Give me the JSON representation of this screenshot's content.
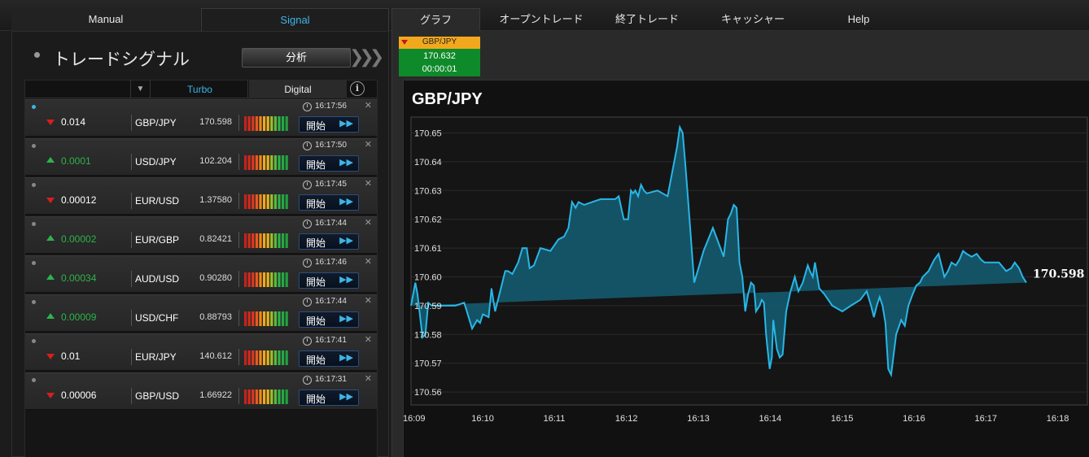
{
  "nav": {
    "manual": "Manual",
    "signal": "Signal",
    "graph": "グラフ",
    "open_trades": "オープントレード",
    "closed_trades": "終了トレード",
    "cashier": "キャッシャー",
    "help": "Help"
  },
  "signal_panel": {
    "title": "トレードシグナル",
    "analyze_label": "分析",
    "filter_value": "",
    "subtabs": {
      "turbo": "Turbo",
      "digital": "Digital"
    },
    "info_icon": "i",
    "rows": [
      {
        "direction": "down",
        "change": "0.014",
        "pair": "GBP/JPY",
        "price": "170.598",
        "time": "16:17:56",
        "active": true,
        "start": "開始"
      },
      {
        "direction": "up",
        "change": "0.0001",
        "pair": "USD/JPY",
        "price": "102.204",
        "time": "16:17:50",
        "active": false,
        "start": "開始"
      },
      {
        "direction": "down",
        "change": "0.00012",
        "pair": "EUR/USD",
        "price": "1.37580",
        "time": "16:17:45",
        "active": false,
        "start": "開始"
      },
      {
        "direction": "up",
        "change": "0.00002",
        "pair": "EUR/GBP",
        "price": "0.82421",
        "time": "16:17:44",
        "active": false,
        "start": "開始"
      },
      {
        "direction": "up",
        "change": "0.00034",
        "pair": "AUD/USD",
        "price": "0.90280",
        "time": "16:17:46",
        "active": false,
        "start": "開始"
      },
      {
        "direction": "up",
        "change": "0.00009",
        "pair": "USD/CHF",
        "price": "0.88793",
        "time": "16:17:44",
        "active": false,
        "start": "開始"
      },
      {
        "direction": "down",
        "change": "0.01",
        "pair": "EUR/JPY",
        "price": "140.612",
        "time": "16:17:41",
        "active": false,
        "start": "開始"
      },
      {
        "direction": "down",
        "change": "0.00006",
        "pair": "GBP/USD",
        "price": "1.66922",
        "time": "16:17:31",
        "active": false,
        "start": "開始"
      }
    ],
    "icons": {
      "close": "close-icon",
      "clock": "clock-icon",
      "start": "fast-forward-icon",
      "down": "triangle-down-icon",
      "up": "triangle-up-icon"
    },
    "colors": {
      "down": "#d91e1e",
      "up": "#2db34a",
      "accent": "#3fb4e6"
    }
  },
  "asset_chip": {
    "pair": "GBP/JPY",
    "price": "170.632",
    "timer": "00:00:01",
    "colors": {
      "head": "#f2a81d",
      "body": "#0f8a2a"
    }
  },
  "chart_data": {
    "type": "area",
    "title": "GBP/JPY",
    "last_price_label": "170.598",
    "xlabel": "",
    "ylabel": "",
    "x_ticks": [
      "16:09",
      "16:10",
      "16:11",
      "16:12",
      "16:13",
      "16:14",
      "16:15",
      "16:16",
      "16:17",
      "16:18"
    ],
    "y_ticks": [
      "170.56",
      "170.57",
      "170.58",
      "170.59",
      "170.60",
      "170.61",
      "170.62",
      "170.63",
      "170.64",
      "170.65"
    ],
    "xlim": [
      0,
      9.41
    ],
    "ylim": [
      170.5555,
      170.6555
    ],
    "grid": true,
    "legend": "none",
    "colors": {
      "line": "#29b6e6",
      "fill": "#145a6e"
    },
    "x": [
      0.0,
      0.06,
      0.09,
      0.16,
      0.2,
      0.24,
      0.29,
      0.38,
      0.41,
      0.46,
      0.53,
      0.62,
      0.74,
      0.85,
      0.92,
      0.96,
      1.0,
      1.08,
      1.12,
      1.17,
      1.22,
      1.27,
      1.31,
      1.35,
      1.41,
      1.49,
      1.55,
      1.61,
      1.65,
      1.71,
      1.8,
      1.94,
      2.05,
      2.13,
      2.19,
      2.24,
      2.29,
      2.33,
      2.41,
      2.52,
      2.64,
      2.76,
      2.84,
      2.89,
      2.96,
      3.02,
      3.06,
      3.09,
      3.12,
      3.16,
      3.2,
      3.24,
      3.28,
      3.43,
      3.57,
      3.7,
      3.74,
      3.78,
      3.82,
      3.86,
      3.94,
      4.07,
      4.2,
      4.35,
      4.41,
      4.45,
      4.49,
      4.53,
      4.57,
      4.61,
      4.65,
      4.69,
      4.73,
      4.77,
      4.8,
      4.85,
      4.88,
      4.91,
      4.94,
      4.96,
      4.99,
      5.02,
      5.04,
      5.09,
      5.13,
      5.17,
      5.22,
      5.28,
      5.34,
      5.39,
      5.45,
      5.52,
      5.55,
      5.59,
      5.62,
      5.68,
      5.75,
      5.86,
      6.0,
      6.12,
      6.25,
      6.34,
      6.4,
      6.44,
      6.48,
      6.52,
      6.56,
      6.6,
      6.64,
      6.68,
      6.75,
      6.82,
      6.87,
      6.92,
      6.98,
      7.03,
      7.08,
      7.12,
      7.2,
      7.28,
      7.34,
      7.38,
      7.42,
      7.47,
      7.52,
      7.58,
      7.63,
      7.68,
      7.73,
      7.8,
      7.87,
      7.93,
      7.98,
      8.08,
      8.18,
      8.28,
      8.35,
      8.4,
      8.46,
      8.51,
      8.56,
      8.64,
      8.72,
      8.8,
      8.87,
      8.95,
      9.0,
      9.06,
      9.12,
      9.2,
      9.27,
      9.34,
      9.41
    ],
    "y": [
      170.59,
      170.598,
      170.594,
      170.579,
      170.58,
      170.591,
      170.59,
      170.59,
      170.59,
      170.59,
      170.59,
      170.59,
      170.591,
      170.582,
      170.585,
      170.584,
      170.587,
      170.586,
      170.596,
      170.588,
      170.593,
      170.598,
      170.602,
      170.602,
      170.601,
      170.605,
      170.61,
      170.61,
      170.603,
      170.604,
      170.61,
      170.609,
      170.613,
      170.614,
      170.617,
      170.626,
      170.624,
      170.626,
      170.625,
      170.626,
      170.627,
      170.627,
      170.627,
      170.628,
      170.62,
      170.62,
      170.63,
      170.629,
      170.63,
      170.628,
      170.632,
      170.63,
      170.629,
      170.63,
      170.628,
      170.645,
      170.652,
      170.65,
      170.638,
      170.625,
      170.598,
      170.609,
      170.617,
      170.607,
      170.62,
      170.622,
      170.625,
      170.624,
      170.605,
      170.6,
      170.588,
      170.594,
      170.598,
      170.597,
      170.588,
      170.59,
      170.592,
      170.591,
      170.58,
      170.575,
      170.568,
      170.572,
      170.585,
      170.575,
      170.572,
      170.573,
      170.588,
      170.595,
      170.6,
      170.595,
      170.598,
      170.604,
      170.602,
      170.6,
      170.605,
      170.596,
      170.594,
      170.59,
      170.588,
      170.59,
      170.592,
      170.595,
      170.59,
      170.586,
      170.59,
      170.593,
      170.59,
      170.584,
      170.568,
      170.566,
      170.58,
      170.585,
      170.583,
      170.59,
      170.594,
      170.597,
      170.598,
      170.6,
      170.602,
      170.606,
      170.608,
      170.604,
      170.6,
      170.602,
      170.605,
      170.604,
      170.606,
      170.609,
      170.608,
      170.607,
      170.608,
      170.606,
      170.605,
      170.605,
      170.605,
      170.602,
      170.603,
      170.605,
      170.603,
      170.6,
      170.598
    ]
  }
}
